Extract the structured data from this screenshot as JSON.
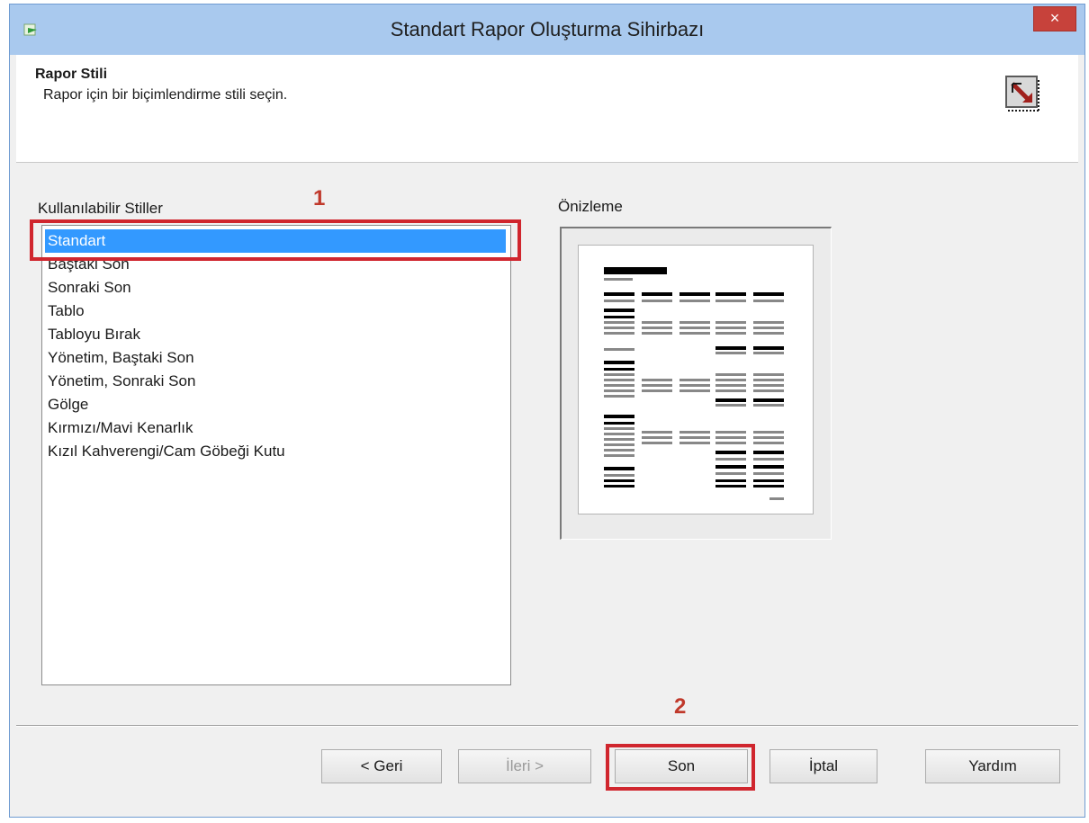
{
  "window": {
    "title": "Standart Rapor Oluşturma Sihirbazı",
    "close_label": "×"
  },
  "header": {
    "title": "Rapor Stili",
    "subtitle": "Rapor için bir biçimlendirme stili seçin."
  },
  "styles": {
    "label": "Kullanılabilir Stiller",
    "items": [
      "Standart",
      "Baştaki Son",
      "Sonraki Son",
      "Tablo",
      "Tabloyu Bırak",
      "Yönetim, Baştaki Son",
      "Yönetim, Sonraki Son",
      "Gölge",
      "Kırmızı/Mavi Kenarlık",
      "Kızıl Kahverengi/Cam Göbeği Kutu"
    ],
    "selected_index": 0
  },
  "preview": {
    "label": "Önizleme"
  },
  "buttons": {
    "back": "< Geri",
    "next": "İleri >",
    "finish": "Son",
    "cancel": "İptal",
    "help": "Yardım"
  },
  "annotations": {
    "step1": "1",
    "step2": "2",
    "color": "#d0262e"
  },
  "colors": {
    "titlebar": "#a9c9ee",
    "selection": "#3399ff",
    "close": "#c7423b"
  }
}
